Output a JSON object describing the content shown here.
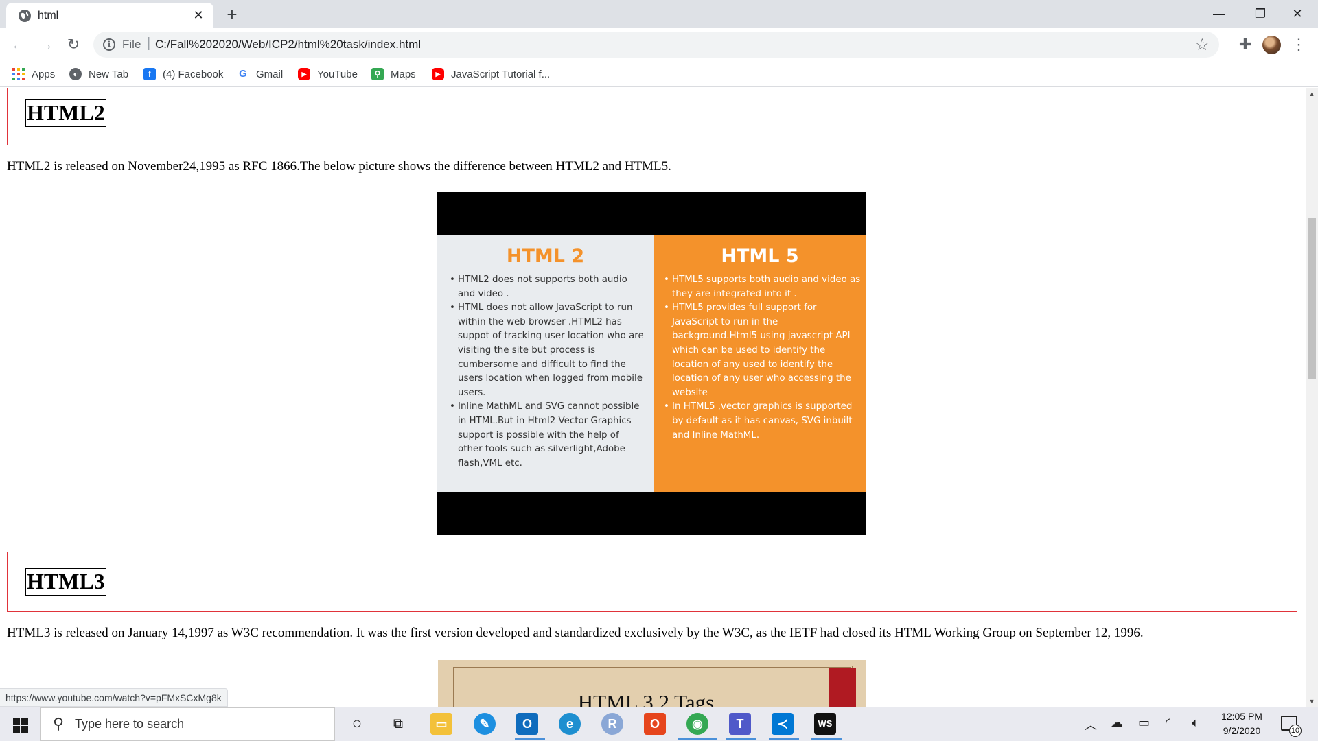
{
  "browser": {
    "tab_title": "html",
    "address_scheme": "File",
    "address_url": "C:/Fall%202020/Web/ICP2/html%20task/index.html",
    "status_url": "https://www.youtube.com/watch?v=pFMxSCxMg8k"
  },
  "bookmarks": [
    {
      "label": "Apps",
      "icon": "apps-grid-icon",
      "color": "#ea4335"
    },
    {
      "label": "New Tab",
      "icon": "globe-icon",
      "color": "#5f6368"
    },
    {
      "label": "(4) Facebook",
      "icon": "facebook-icon",
      "color": "#1877f2"
    },
    {
      "label": "Gmail",
      "icon": "google-icon",
      "color": "#4285f4"
    },
    {
      "label": "YouTube",
      "icon": "youtube-icon",
      "color": "#ff0000"
    },
    {
      "label": "Maps",
      "icon": "maps-icon",
      "color": "#34a853"
    },
    {
      "label": "JavaScript Tutorial f...",
      "icon": "youtube-icon",
      "color": "#ff0000"
    }
  ],
  "page": {
    "html2_heading": "HTML2",
    "html2_text": "HTML2 is released on November24,1995 as RFC 1866.The below picture shows the difference between HTML2 and HTML5.",
    "html3_heading": "HTML3",
    "html3_text": "HTML3 is released on January 14,1997 as W3C recommendation. It was the first version developed and standardized exclusively by the W3C, as the IETF had closed its HTML Working Group on September 12, 1996."
  },
  "figure_compare": {
    "left_title": "HTML 2",
    "left_items": [
      "HTML2 does not supports both audio and video .",
      "HTML does not allow JavaScript to run within the web browser .HTML2 has suppot of tracking user location who are visiting the site but process is cumbersome and difficult to find the users location when logged from mobile users.",
      "Inline MathML and SVG cannot possible in HTML.But in  Html2 Vector Graphics support is possible with the help of other tools such as silverlight,Adobe flash,VML etc."
    ],
    "right_title": "HTML 5",
    "right_items": [
      "HTML5 supports both audio and video as they are integrated into it .",
      "HTML5 provides full support for JavaScript to run in the background.Html5 using javascript API which can be used to identify the location of any used to identify the location of any user who accessing the website",
      "In HTML5 ,vector graphics is supported by default as it has canvas, SVG inbuilt and Inline MathML."
    ],
    "left_title_color": "#f4922b",
    "right_bg_color": "#f4922b"
  },
  "figure_tags": {
    "title": "HTML 3.2 Tags"
  },
  "taskbar": {
    "search_placeholder": "Type here to search",
    "time": "12:05 PM",
    "date": "9/2/2020",
    "notification_count": "10"
  }
}
